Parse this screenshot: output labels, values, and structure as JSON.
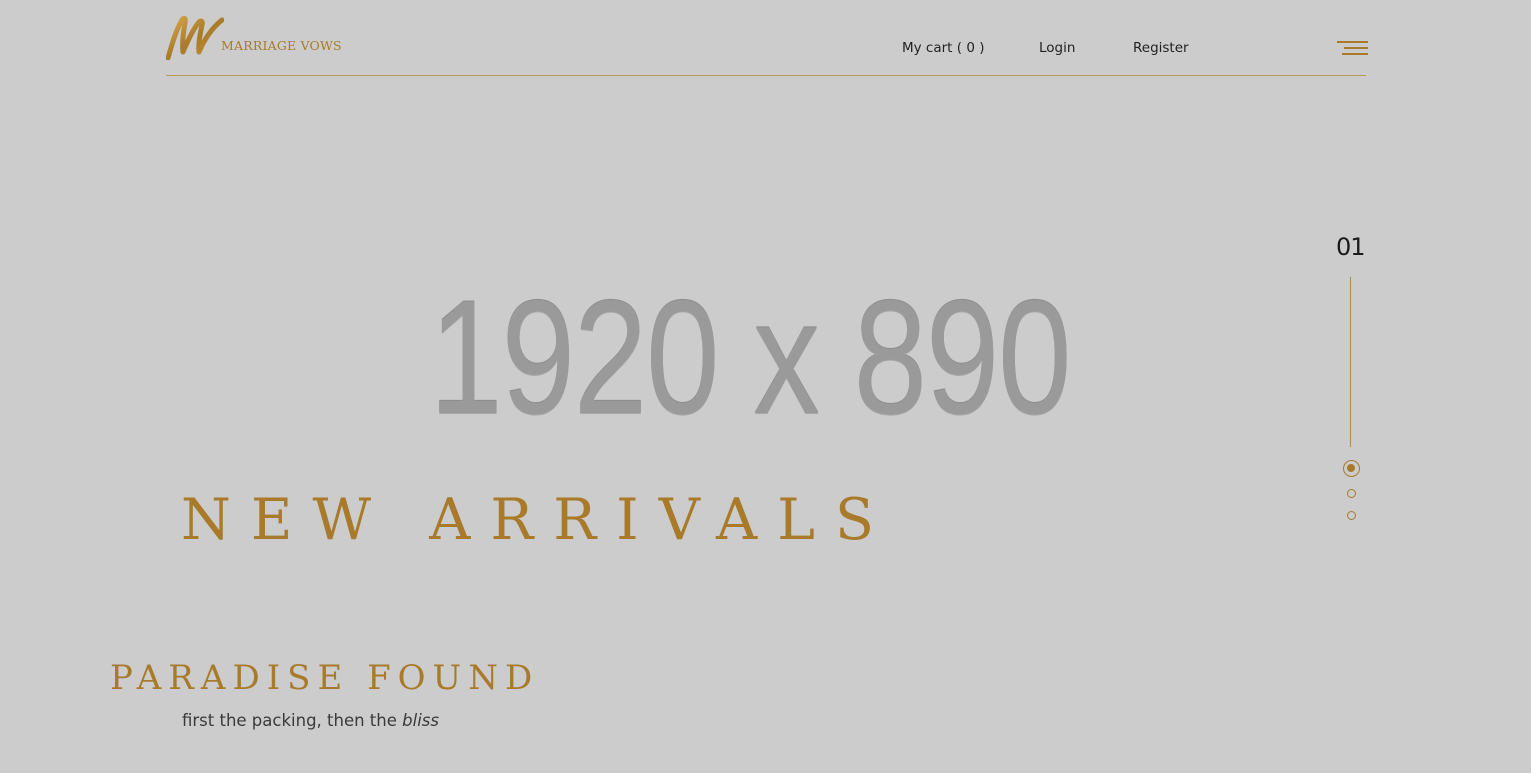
{
  "brand": {
    "name": "MARRIAGE VOWS",
    "logo_icon": "mw-script-logo"
  },
  "nav": {
    "cart": "My cart ( 0 )",
    "login": "Login",
    "register": "Register",
    "menu_icon": "hamburger-menu-icon"
  },
  "hero": {
    "placeholder": "1920 x 890",
    "headline": "NEW ARRIVALS",
    "slide_number": "01",
    "slides_total": 3,
    "active_slide": 1
  },
  "promo": {
    "title": "PARADISE FOUND",
    "tagline_prefix": "first the packing, then the ",
    "tagline_emphasis": "bliss"
  },
  "colors": {
    "background": "#cccccc",
    "accent_gold": "#a87a2a",
    "text_dark": "#222222"
  }
}
